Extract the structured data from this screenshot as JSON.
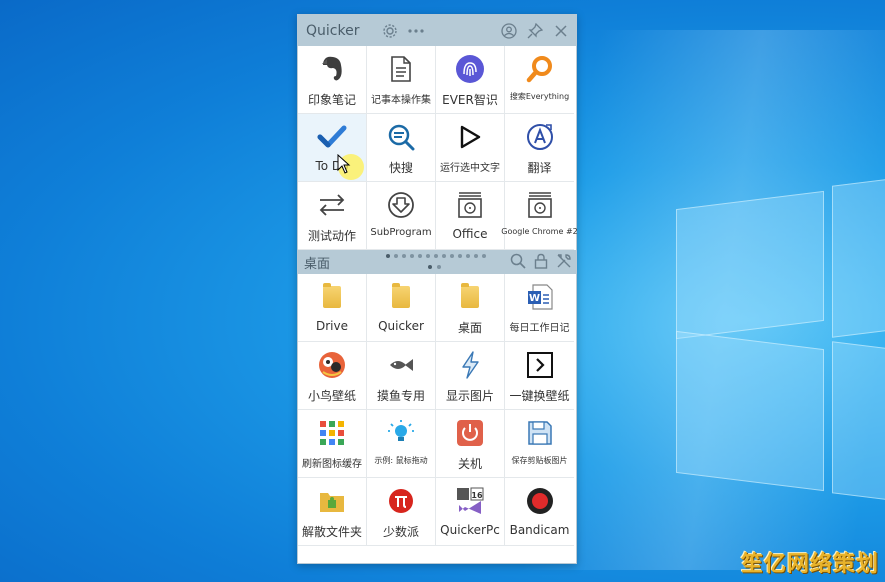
{
  "window": {
    "title": "Quicker"
  },
  "top_actions": [
    {
      "label": "印象笔记",
      "icon": "evernote-icon"
    },
    {
      "label": "记事本操作集",
      "icon": "notepad-icon"
    },
    {
      "label": "EVER智识",
      "icon": "fingerprint-icon"
    },
    {
      "label": "搜索Everything",
      "icon": "search-everything-icon"
    },
    {
      "label": "To Do",
      "icon": "todo-check-icon"
    },
    {
      "label": "快搜",
      "icon": "quick-search-icon"
    },
    {
      "label": "运行选中文字",
      "icon": "play-icon"
    },
    {
      "label": "翻译",
      "icon": "translate-icon"
    },
    {
      "label": "测试动作",
      "icon": "swap-arrows-icon"
    },
    {
      "label": "SubProgram",
      "icon": "download-circle-icon"
    },
    {
      "label": "Office",
      "icon": "office-box-icon"
    },
    {
      "label": "Google Chrome #2",
      "icon": "chrome-box-icon"
    }
  ],
  "section": {
    "title": "桌面"
  },
  "bottom_actions": [
    {
      "label": "Drive",
      "icon": "folder-icon"
    },
    {
      "label": "Quicker",
      "icon": "folder-icon"
    },
    {
      "label": "桌面",
      "icon": "folder-icon"
    },
    {
      "label": "每日工作日记",
      "icon": "word-doc-icon"
    },
    {
      "label": "小鸟壁纸",
      "icon": "bird-wallpaper-icon"
    },
    {
      "label": "摸鱼专用",
      "icon": "fish-icon"
    },
    {
      "label": "显示图片",
      "icon": "lightning-icon"
    },
    {
      "label": "一键换壁纸",
      "icon": "terminal-arrow-icon"
    },
    {
      "label": "刷新图标缓存",
      "icon": "icon-grid-icon"
    },
    {
      "label": "示例: 鼠标拖动",
      "icon": "lightbulb-icon"
    },
    {
      "label": "关机",
      "icon": "power-icon"
    },
    {
      "label": "保存剪贴板图片",
      "icon": "floppy-icon"
    },
    {
      "label": "解散文件夹",
      "icon": "puzzle-folder-icon"
    },
    {
      "label": "少数派",
      "icon": "sspai-icon"
    },
    {
      "label": "QuickerPc",
      "icon": "vs-icon"
    },
    {
      "label": "Bandicam",
      "icon": "record-icon"
    }
  ],
  "watermark": "笙亿网络策划"
}
